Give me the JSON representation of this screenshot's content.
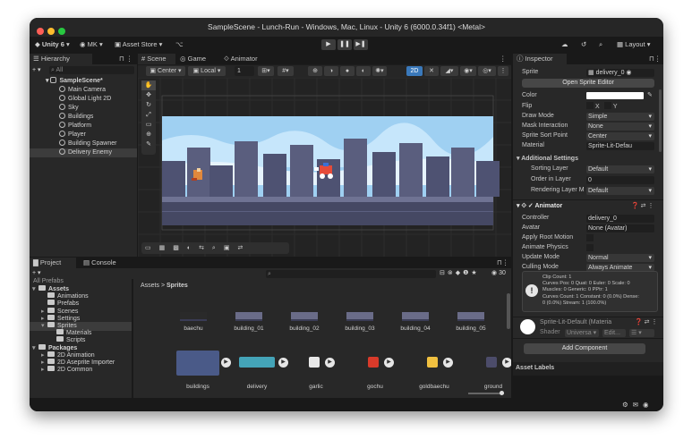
{
  "window": {
    "title": "SampleScene - Lunch-Run - Windows, Mac, Linux - Unity 6 (6000.0.34f1) <Metal>"
  },
  "toolbar": {
    "unity": "Unity 6",
    "account": "MK",
    "store": "Asset Store",
    "layout": "Layout"
  },
  "hierarchy": {
    "tab": "Hierarchy",
    "search": "All",
    "scene": "SampleScene*",
    "items": [
      "Main Camera",
      "Global Light 2D",
      "Sky",
      "Buildings",
      "Platform",
      "Player",
      "Building Spawner",
      "Delivery Enemy"
    ]
  },
  "scene": {
    "tabs": [
      "Scene",
      "Game",
      "Animator"
    ],
    "pivot": "Center",
    "space": "Local",
    "grid": "1",
    "mode2d": "2D"
  },
  "project": {
    "tabs": [
      "Project",
      "Console"
    ],
    "clipped": "All Prefabs",
    "breadcrumb_root": "Assets",
    "breadcrumb_leaf": "Sprites",
    "count": "30",
    "tree": [
      "Assets",
      "Animations",
      "Prefabs",
      "Scenes",
      "Settings",
      "Sprites",
      "Materials",
      "Scripts",
      "Packages",
      "2D Animation",
      "2D Aseprite Importer",
      "2D Common"
    ],
    "row1": [
      "baechu",
      "building_01",
      "building_02",
      "building_03",
      "building_04",
      "building_05"
    ],
    "row2": [
      "buildings",
      "delivery",
      "garlic",
      "gochu",
      "goldbaechu",
      "ground"
    ]
  },
  "inspector": {
    "tab": "Inspector",
    "sprite_label": "Sprite",
    "sprite_value": "delivery_0",
    "open_editor": "Open Sprite Editor",
    "color": "Color",
    "flip": "Flip",
    "flip_x": "X",
    "flip_y": "Y",
    "draw_mode": "Draw Mode",
    "draw_mode_v": "Simple",
    "mask": "Mask Interaction",
    "mask_v": "None",
    "sort_point": "Sprite Sort Point",
    "sort_point_v": "Center",
    "material": "Material",
    "material_v": "Sprite-Lit-Defau",
    "additional": "Additional Settings",
    "sorting_layer": "Sorting Layer",
    "sorting_layer_v": "Default",
    "order": "Order in Layer",
    "order_v": "0",
    "render_layer": "Rendering Layer M",
    "render_layer_v": "Default",
    "animator": "Animator",
    "controller": "Controller",
    "controller_v": "delivery_0",
    "avatar": "Avatar",
    "avatar_v": "None (Avatar)",
    "root_motion": "Apply Root Motion",
    "physics": "Animate Physics",
    "update": "Update Mode",
    "update_v": "Normal",
    "culling": "Culling Mode",
    "culling_v": "Always Animate",
    "info": [
      "Clip Count: 1",
      "Curves Pos: 0 Quat: 0 Euler: 0 Scale: 0",
      "Muscles: 0 Generic: 0 PPtr: 1",
      "Curves Count: 1 Constant: 0 (0.0%) Dense:",
      "0 (0.0%) Stream: 1 (100.0%)"
    ],
    "mat_name": "Sprite-Lit-Default (Materia",
    "shader": "Shader",
    "shader_v": "Universa",
    "edit": "Edit...",
    "add_component": "Add Component",
    "asset_labels": "Asset Labels"
  },
  "colors": {
    "accent": "#3a79bb",
    "panel": "#282828",
    "dark": "#191919"
  }
}
